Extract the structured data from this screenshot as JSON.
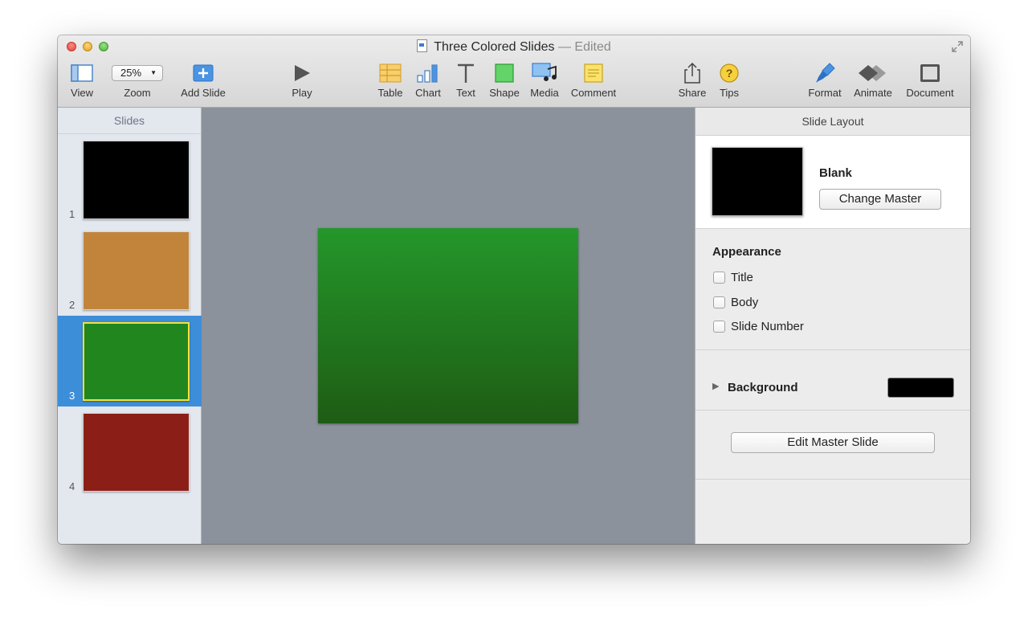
{
  "window": {
    "title": "Three Colored Slides",
    "status": "— Edited"
  },
  "toolbar": {
    "view": "View",
    "zoom_value": "25%",
    "zoom": "Zoom",
    "add_slide": "Add Slide",
    "play": "Play",
    "table": "Table",
    "chart": "Chart",
    "text": "Text",
    "shape": "Shape",
    "media": "Media",
    "comment": "Comment",
    "share": "Share",
    "tips": "Tips",
    "format": "Format",
    "animate": "Animate",
    "document": "Document"
  },
  "sidebar": {
    "header": "Slides",
    "slides": [
      {
        "number": "1",
        "color": "#000000"
      },
      {
        "number": "2",
        "color": "#c2843a"
      },
      {
        "number": "3",
        "color": "#22861f"
      },
      {
        "number": "4",
        "color": "#8b1f18"
      }
    ],
    "selected_index": 3
  },
  "inspector": {
    "header": "Slide Layout",
    "master_name": "Blank",
    "change_master": "Change Master",
    "appearance": "Appearance",
    "options": [
      "Title",
      "Body",
      "Slide Number"
    ],
    "background": "Background",
    "background_color": "#000000",
    "edit_master": "Edit Master Slide"
  }
}
